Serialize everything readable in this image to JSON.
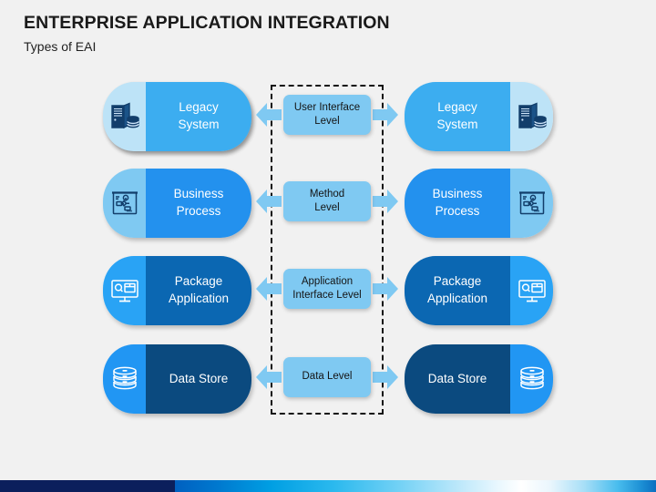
{
  "header": {
    "title": "ENTERPRISE APPLICATION INTEGRATION",
    "subtitle": "Types of EAI"
  },
  "diagram": {
    "rows": [
      {
        "id": "legacy-system",
        "system_label": "Legacy\nSystem",
        "level_label": "User Interface\nLevel",
        "icon": "server-database-icon",
        "body_color": "#3CADF0",
        "icon_pane_color": "#BDE3F7",
        "icon_stroke": "#123E6B"
      },
      {
        "id": "business-process",
        "system_label": "Business\nProcess",
        "level_label": "Method\nLevel",
        "icon": "flowchart-board-icon",
        "body_color": "#2391EE",
        "icon_pane_color": "#7FC9F2",
        "icon_stroke": "#123E6B"
      },
      {
        "id": "package-application",
        "system_label": "Package\nApplication",
        "level_label": "Application\nInterface Level",
        "icon": "monitor-package-icon",
        "body_color": "#0B67B2",
        "icon_pane_color": "#29A3F5",
        "icon_stroke": "#FFFFFF"
      },
      {
        "id": "data-store",
        "system_label": "Data Store",
        "level_label": "Data Level",
        "icon": "database-stack-icon",
        "body_color": "#0B4A7F",
        "icon_pane_color": "#2196F3",
        "icon_stroke": "#FFFFFF"
      }
    ],
    "arrow_color": "#7FC9F2",
    "level_box_color": "#7FC9F2",
    "dashed_border_color": "#111111"
  },
  "bottom_band": {
    "navy_color": "#0b1f5c"
  }
}
